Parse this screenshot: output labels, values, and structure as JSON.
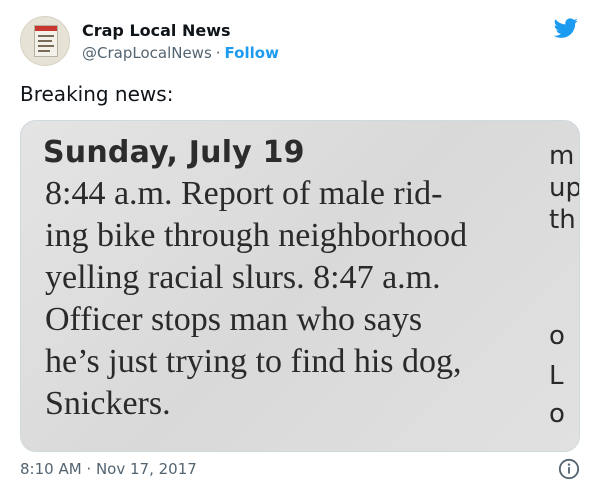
{
  "author": {
    "name": "Crap Local News",
    "handle": "@CrapLocalNews",
    "separator": "·",
    "follow_label": "Follow"
  },
  "tweet": {
    "text": "Breaking news:",
    "timestamp": "8:10 AM · Nov 17, 2017"
  },
  "media": {
    "heading": "Sunday, July 19",
    "lines": [
      "8:44 a.m. Report of male rid-",
      "ing bike through neighborhood",
      "yelling racial slurs. 8:47 a.m.",
      "Officer stops man who says",
      "he’s just trying to find his dog,",
      "Snickers."
    ],
    "right_column_fragments": [
      "m",
      "up",
      "th",
      "o",
      "L",
      "o"
    ]
  },
  "icons": {
    "brand": "twitter-bird-icon",
    "info": "info-icon"
  },
  "colors": {
    "accent": "#1d9bf0",
    "text": "#0f1419",
    "secondary": "#536471"
  }
}
